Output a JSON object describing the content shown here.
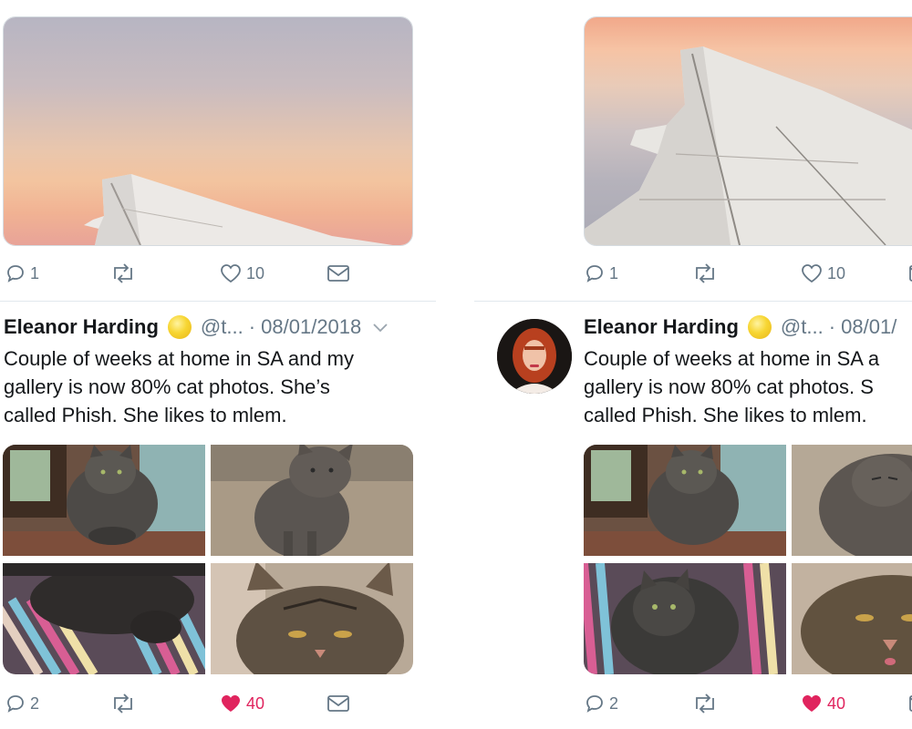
{
  "tweets": {
    "left": {
      "top_actions": {
        "reply_count": "1",
        "like_count": "10"
      },
      "author": {
        "name": "Eleanor Harding",
        "handle": "@t...",
        "date": "· 08/01/2018"
      },
      "text_lines": [
        "Couple of weeks at home in SA and my",
        "gallery is now 80% cat photos. She’s",
        "called Phish. She likes to mlem."
      ],
      "bottom_actions": {
        "reply_count": "2",
        "like_count": "40"
      }
    },
    "right": {
      "top_actions": {
        "reply_count": "1",
        "like_count": "10"
      },
      "author": {
        "name": "Eleanor Harding",
        "handle": "@t...",
        "date": "· 08/01/"
      },
      "text_lines": [
        "Couple of weeks at home in SA a",
        "gallery is now 80% cat photos. S",
        "called Phish. She likes to mlem."
      ],
      "bottom_actions": {
        "reply_count": "2",
        "like_count": "40"
      }
    }
  },
  "icons": {
    "reply": "reply-icon",
    "retweet": "retweet-icon",
    "like": "heart-icon",
    "dm": "envelope-icon",
    "verified": "moon-icon",
    "more": "chevron-down-icon"
  },
  "colors": {
    "liked": "#e0245e",
    "muted": "#657786",
    "text": "#14171a"
  }
}
